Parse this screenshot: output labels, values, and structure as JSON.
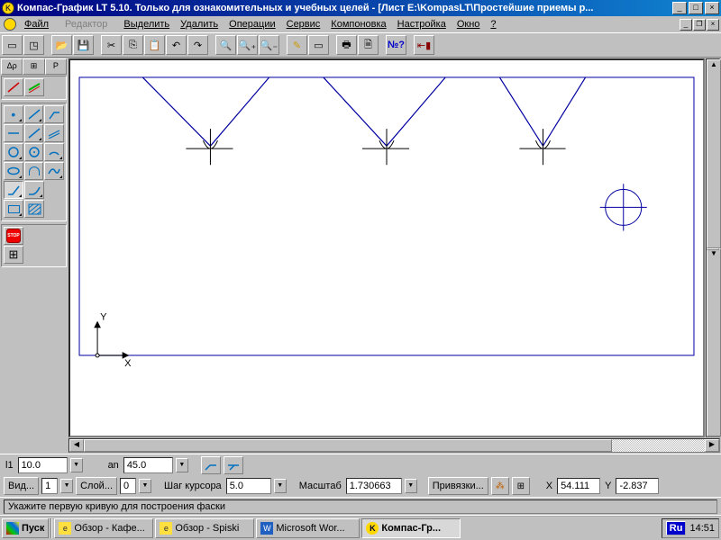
{
  "window": {
    "title": "Компас-График LT 5.10. Только для ознакомительных и учебных целей - [Лист E:\\KompasLT\\Простейшие приемы р...",
    "min": "_",
    "max": "□",
    "close": "×"
  },
  "menu": {
    "file": "Файл",
    "edit": "Редактор",
    "select": "Выделить",
    "delete": "Удалить",
    "ops": "Операции",
    "service": "Сервис",
    "layout": "Компоновка",
    "settings": "Настройка",
    "window": "Окно",
    "help": "?"
  },
  "mdi": {
    "min": "_",
    "max": "❐",
    "close": "×"
  },
  "left_tabs": {
    "t1": "Δρ",
    "t2": "⊞",
    "t3": "P"
  },
  "stop": "STOP",
  "canvas": {
    "x_label": "X",
    "y_label": "Y"
  },
  "params": {
    "l1_label": "l1",
    "l1_val": "10.0",
    "an_label": "an",
    "an_val": "45.0"
  },
  "bottom": {
    "view": "Вид...",
    "view_val": "1",
    "layer": "Слой...",
    "layer_val": "0",
    "step_label": "Шаг курсора",
    "step_val": "5.0",
    "scale_label": "Масштаб",
    "scale_val": "1.730663",
    "snap": "Привязки...",
    "x_label": "X",
    "x_val": "54.111",
    "y_label": "Y",
    "y_val": "-2.837"
  },
  "status": "Укажите первую кривую для построения фаски",
  "taskbar": {
    "start": "Пуск",
    "t1": "Обзор - Кафе...",
    "t2": "Обзор - Spiski",
    "t3": "Microsoft Wor...",
    "t4": "Компас-Гр...",
    "lang": "Ru",
    "time": "14:51"
  }
}
